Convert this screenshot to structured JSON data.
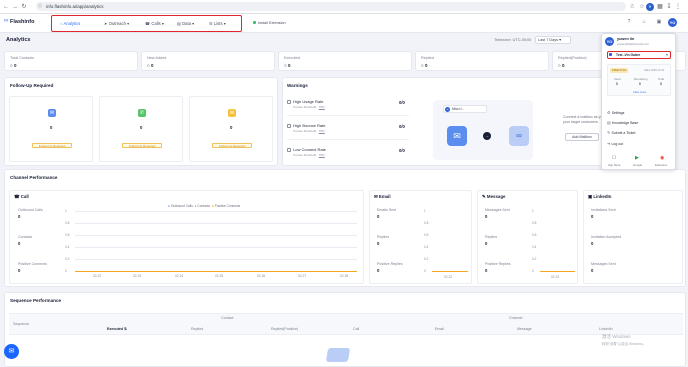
{
  "browser": {
    "url": "info.flashinfo.ai/app/analytics"
  },
  "app": {
    "logo_text": "Flashinfo",
    "menu": [
      {
        "label": "Analytics",
        "icon": "chart-icon"
      },
      {
        "label": "Outreach",
        "icon": "send-icon"
      },
      {
        "label": "Calls",
        "icon": "phone-icon"
      },
      {
        "label": "Data",
        "icon": "database-icon"
      },
      {
        "label": "Lists",
        "icon": "list-icon"
      }
    ],
    "install_extension": "Install Extension"
  },
  "page": {
    "title": "Analytics",
    "timezone": "Timezone: UTC-05:00",
    "date_range": "Last 7 Days"
  },
  "stats": [
    {
      "label": "Total Contacts",
      "value": "0"
    },
    {
      "label": "New Added",
      "value": "0"
    },
    {
      "label": "Executed",
      "value": "0"
    },
    {
      "label": "Replied",
      "value": "0"
    },
    {
      "label": "Replied(Positive)",
      "value": "0"
    }
  ],
  "follow_up": {
    "title": "Follow-Up Required",
    "button": "Follow-Up Required",
    "values": [
      "0",
      "0",
      "0"
    ],
    "colors": [
      "#5b8def",
      "#57c46a",
      "#f5c33b"
    ]
  },
  "warnings": {
    "title": "Warnings",
    "items": [
      {
        "title": "High Usage Rate",
        "sub": "Current threshold :",
        "link": "70%",
        "value": "0/0"
      },
      {
        "title": "High Bounce Rate",
        "sub": "Current threshold :",
        "link": "70%",
        "value": "0/0"
      },
      {
        "title": "Low Connect Rate",
        "sub": "Current threshold :",
        "link": "70%",
        "value": "0/0"
      }
    ]
  },
  "mailbox": {
    "chip": "Mbox.f...",
    "text1": "Connect a mailbox as you",
    "text2": "your target customers",
    "button": "Add Mailbox"
  },
  "channel": {
    "title": "Channel Performance",
    "call": {
      "title": "Call",
      "rows": [
        {
          "label": "Outbound Calls",
          "value": "0"
        },
        {
          "label": "Contacts",
          "value": "0"
        },
        {
          "label": "Positive Connects",
          "value": "0"
        }
      ],
      "legend": [
        "Outbound Calls",
        "Contacts",
        "Positive Connects"
      ],
      "yticks": [
        "1",
        "0.8",
        "0.6",
        "0.4",
        "0.2",
        "0"
      ],
      "xticks": [
        "02-22",
        "02-23",
        "02-24",
        "02-25",
        "02-26",
        "02-27",
        "02-28"
      ]
    },
    "email": {
      "title": "Email",
      "rows": [
        {
          "label": "Emails Sent",
          "value": "0"
        },
        {
          "label": "Replies",
          "value": "0"
        },
        {
          "label": "Positive Replies",
          "value": "0"
        }
      ],
      "yticks": [
        "1",
        "0.8",
        "0.6",
        "0.4",
        "0.2",
        "0"
      ],
      "xtick": "02-22"
    },
    "message": {
      "title": "Message",
      "rows": [
        {
          "label": "Messages Sent",
          "value": "0"
        },
        {
          "label": "Replies",
          "value": "0"
        },
        {
          "label": "Positive Replies",
          "value": "0"
        }
      ],
      "yticks": [
        "1",
        "0.8",
        "0.6",
        "0.4",
        "0.2",
        "0"
      ],
      "xtick": "02-22"
    },
    "linkedin": {
      "title": "LinkedIn",
      "rows": [
        {
          "label": "Invitations Sent",
          "value": "0"
        },
        {
          "label": "Invitation Accepted",
          "value": "0"
        },
        {
          "label": "Messages Sent",
          "value": "0"
        }
      ]
    }
  },
  "sequence": {
    "title": "Sequence Performance",
    "group_contact": "Contact",
    "group_channel": "Channel",
    "col_sequence": "Sequence",
    "cols": [
      "Executed ⇅",
      "Replied",
      "Replied(Positive)",
      "Call",
      "Email",
      "Message",
      "LinkedIn"
    ]
  },
  "popup": {
    "name": "yuwen lin",
    "email": "yuwen@flashinfosoft.com",
    "team_label": "Test -Vin Guber",
    "plan_badge": "FREE PLAN",
    "plan_date": "Valid: 2025-12-31",
    "credit_cols": [
      "Used",
      "Remaining",
      "Total"
    ],
    "credit_vals": [
      "0",
      "0",
      "0"
    ],
    "view_more": "View more",
    "items": [
      {
        "label": "Settings",
        "icon": "gear-icon"
      },
      {
        "label": "Knowledge Base",
        "icon": "book-icon"
      },
      {
        "label": "Submit a Ticket",
        "icon": "ticket-icon"
      },
      {
        "label": "Log out",
        "icon": "logout-icon"
      }
    ],
    "stores": [
      "App Store",
      "Google",
      "Extension"
    ]
  },
  "windows_watermark": {
    "line1": "激活 Windows",
    "line2": "转到“设置”以激活 Windows。"
  },
  "colors": {
    "accent": "#2f6df6",
    "highlight": "#e0262e",
    "email_card": "#5b8def"
  }
}
